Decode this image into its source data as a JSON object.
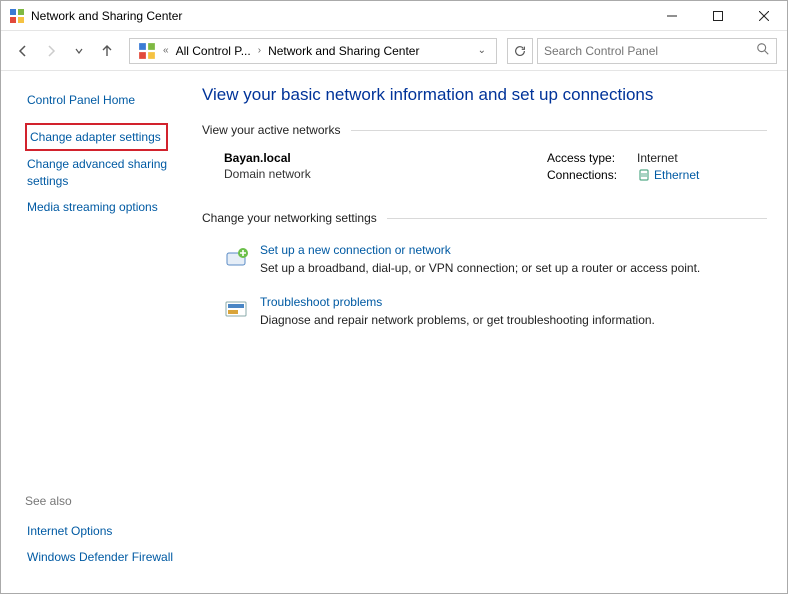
{
  "window": {
    "title": "Network and Sharing Center"
  },
  "navbar": {
    "breadcrumb": {
      "seg1": "All Control P...",
      "seg2": "Network and Sharing Center"
    },
    "search_placeholder": "Search Control Panel"
  },
  "sidebar": {
    "home": "Control Panel Home",
    "items": [
      "Change adapter settings",
      "Change advanced sharing settings",
      "Media streaming options"
    ],
    "seealso_header": "See also",
    "seealso": [
      "Internet Options",
      "Windows Defender Firewall"
    ]
  },
  "main": {
    "title": "View your basic network information and set up connections",
    "active_networks_header": "View your active networks",
    "network": {
      "name": "Bayan.local",
      "type": "Domain network",
      "access_label": "Access type:",
      "access_value": "Internet",
      "connections_label": "Connections:",
      "connections_value": "Ethernet"
    },
    "change_settings_header": "Change your networking settings",
    "settings": [
      {
        "link": "Set up a new connection or network",
        "desc": "Set up a broadband, dial-up, or VPN connection; or set up a router or access point."
      },
      {
        "link": "Troubleshoot problems",
        "desc": "Diagnose and repair network problems, or get troubleshooting information."
      }
    ]
  }
}
